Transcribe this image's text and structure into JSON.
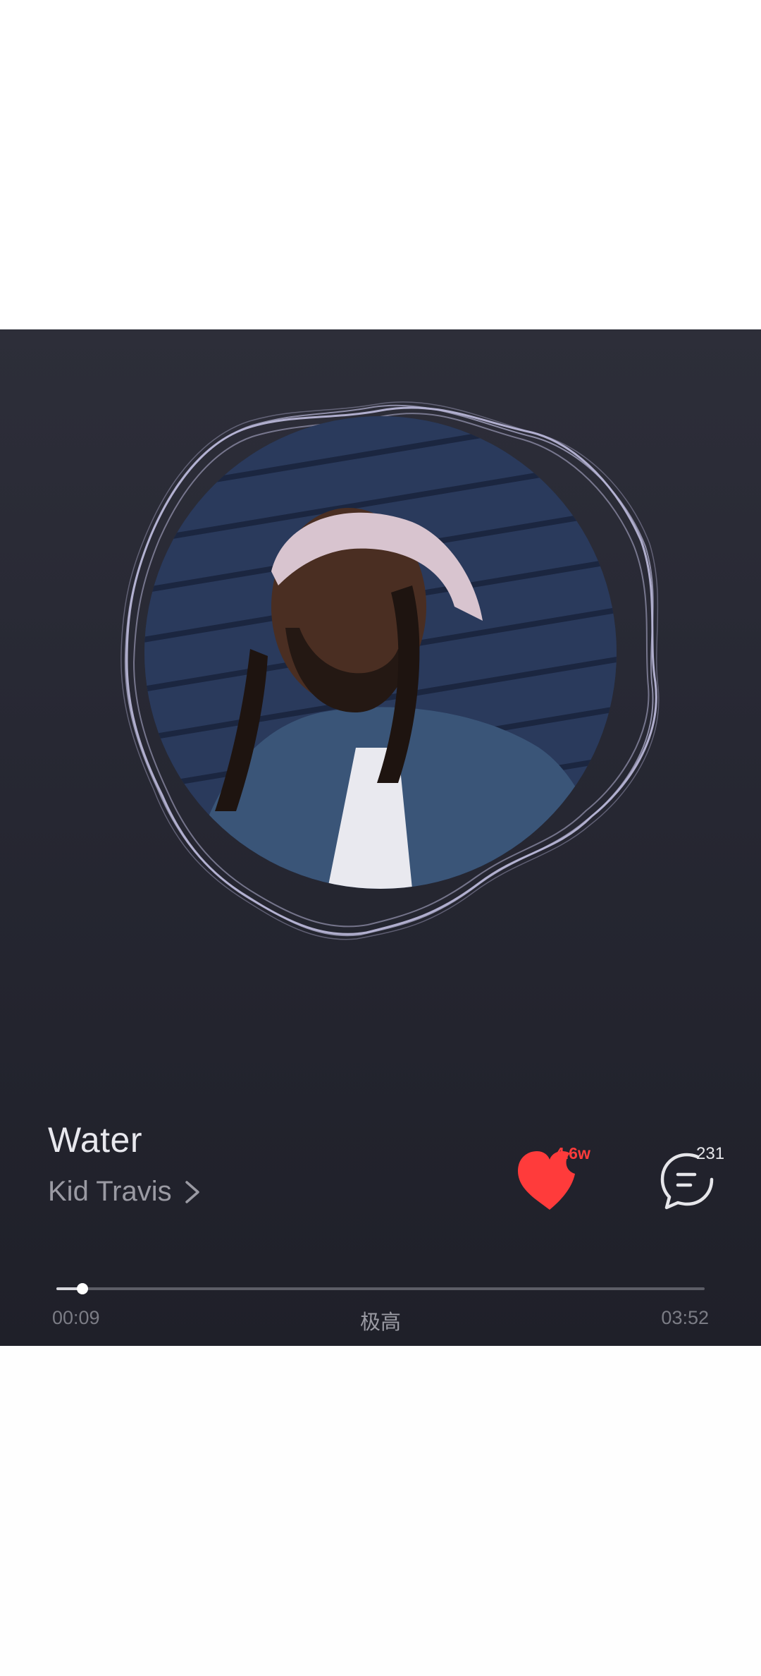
{
  "song": {
    "title": "Water",
    "artist": "Kid Travis"
  },
  "actions": {
    "like_count": "4.6w",
    "comment_count": "231"
  },
  "playback": {
    "current_time": "00:09",
    "total_time": "03:52",
    "quality": "极高",
    "progress": 0.04
  },
  "colors": {
    "background": "#272833",
    "like_accent": "#ff3b3b",
    "wave_ring": "#b7b5d6"
  },
  "icons": {
    "like": "heart-icon",
    "comment": "comment-icon",
    "artist_more": "chevron-right-icon"
  }
}
